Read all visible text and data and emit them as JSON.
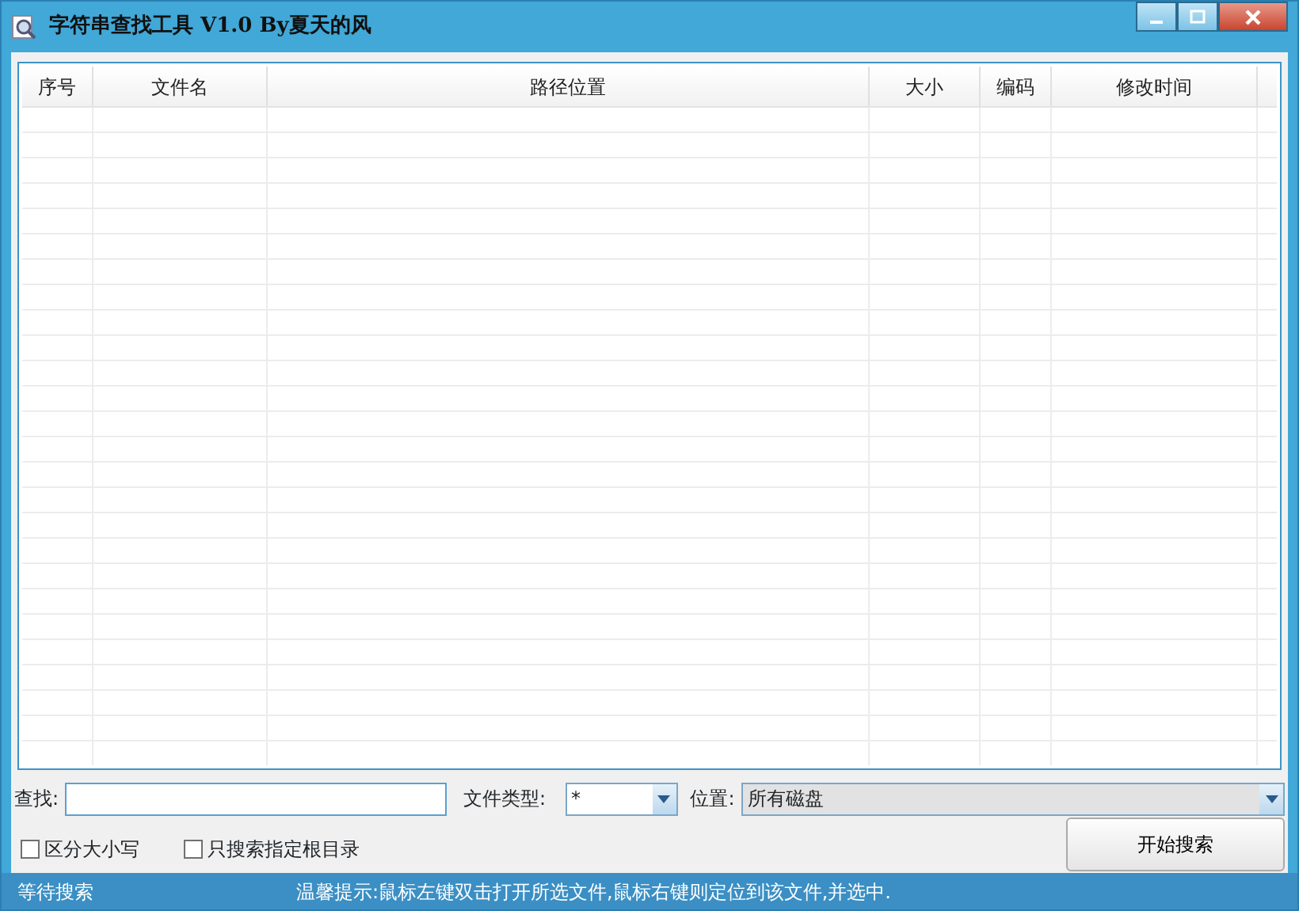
{
  "window": {
    "title": "字符串查找工具  V1.0  By夏天的风"
  },
  "table": {
    "columns": [
      "序号",
      "文件名",
      "路径位置",
      "大小",
      "编码",
      "修改时间"
    ]
  },
  "search": {
    "label": "查找:"
  },
  "file_type": {
    "label": "文件类型:",
    "value": "*"
  },
  "location": {
    "label": "位置:",
    "value": "所有磁盘"
  },
  "options": [
    {
      "label": "区分大小写",
      "checked": false
    },
    {
      "label": "只搜索指定根目录",
      "checked": false
    }
  ],
  "buttons": [
    "开始搜索"
  ],
  "status_bar": {
    "state": "等待搜索",
    "hint": "温馨提示:鼠标左键双击打开所选文件,鼠标右键则定位到该文件,并选中."
  }
}
